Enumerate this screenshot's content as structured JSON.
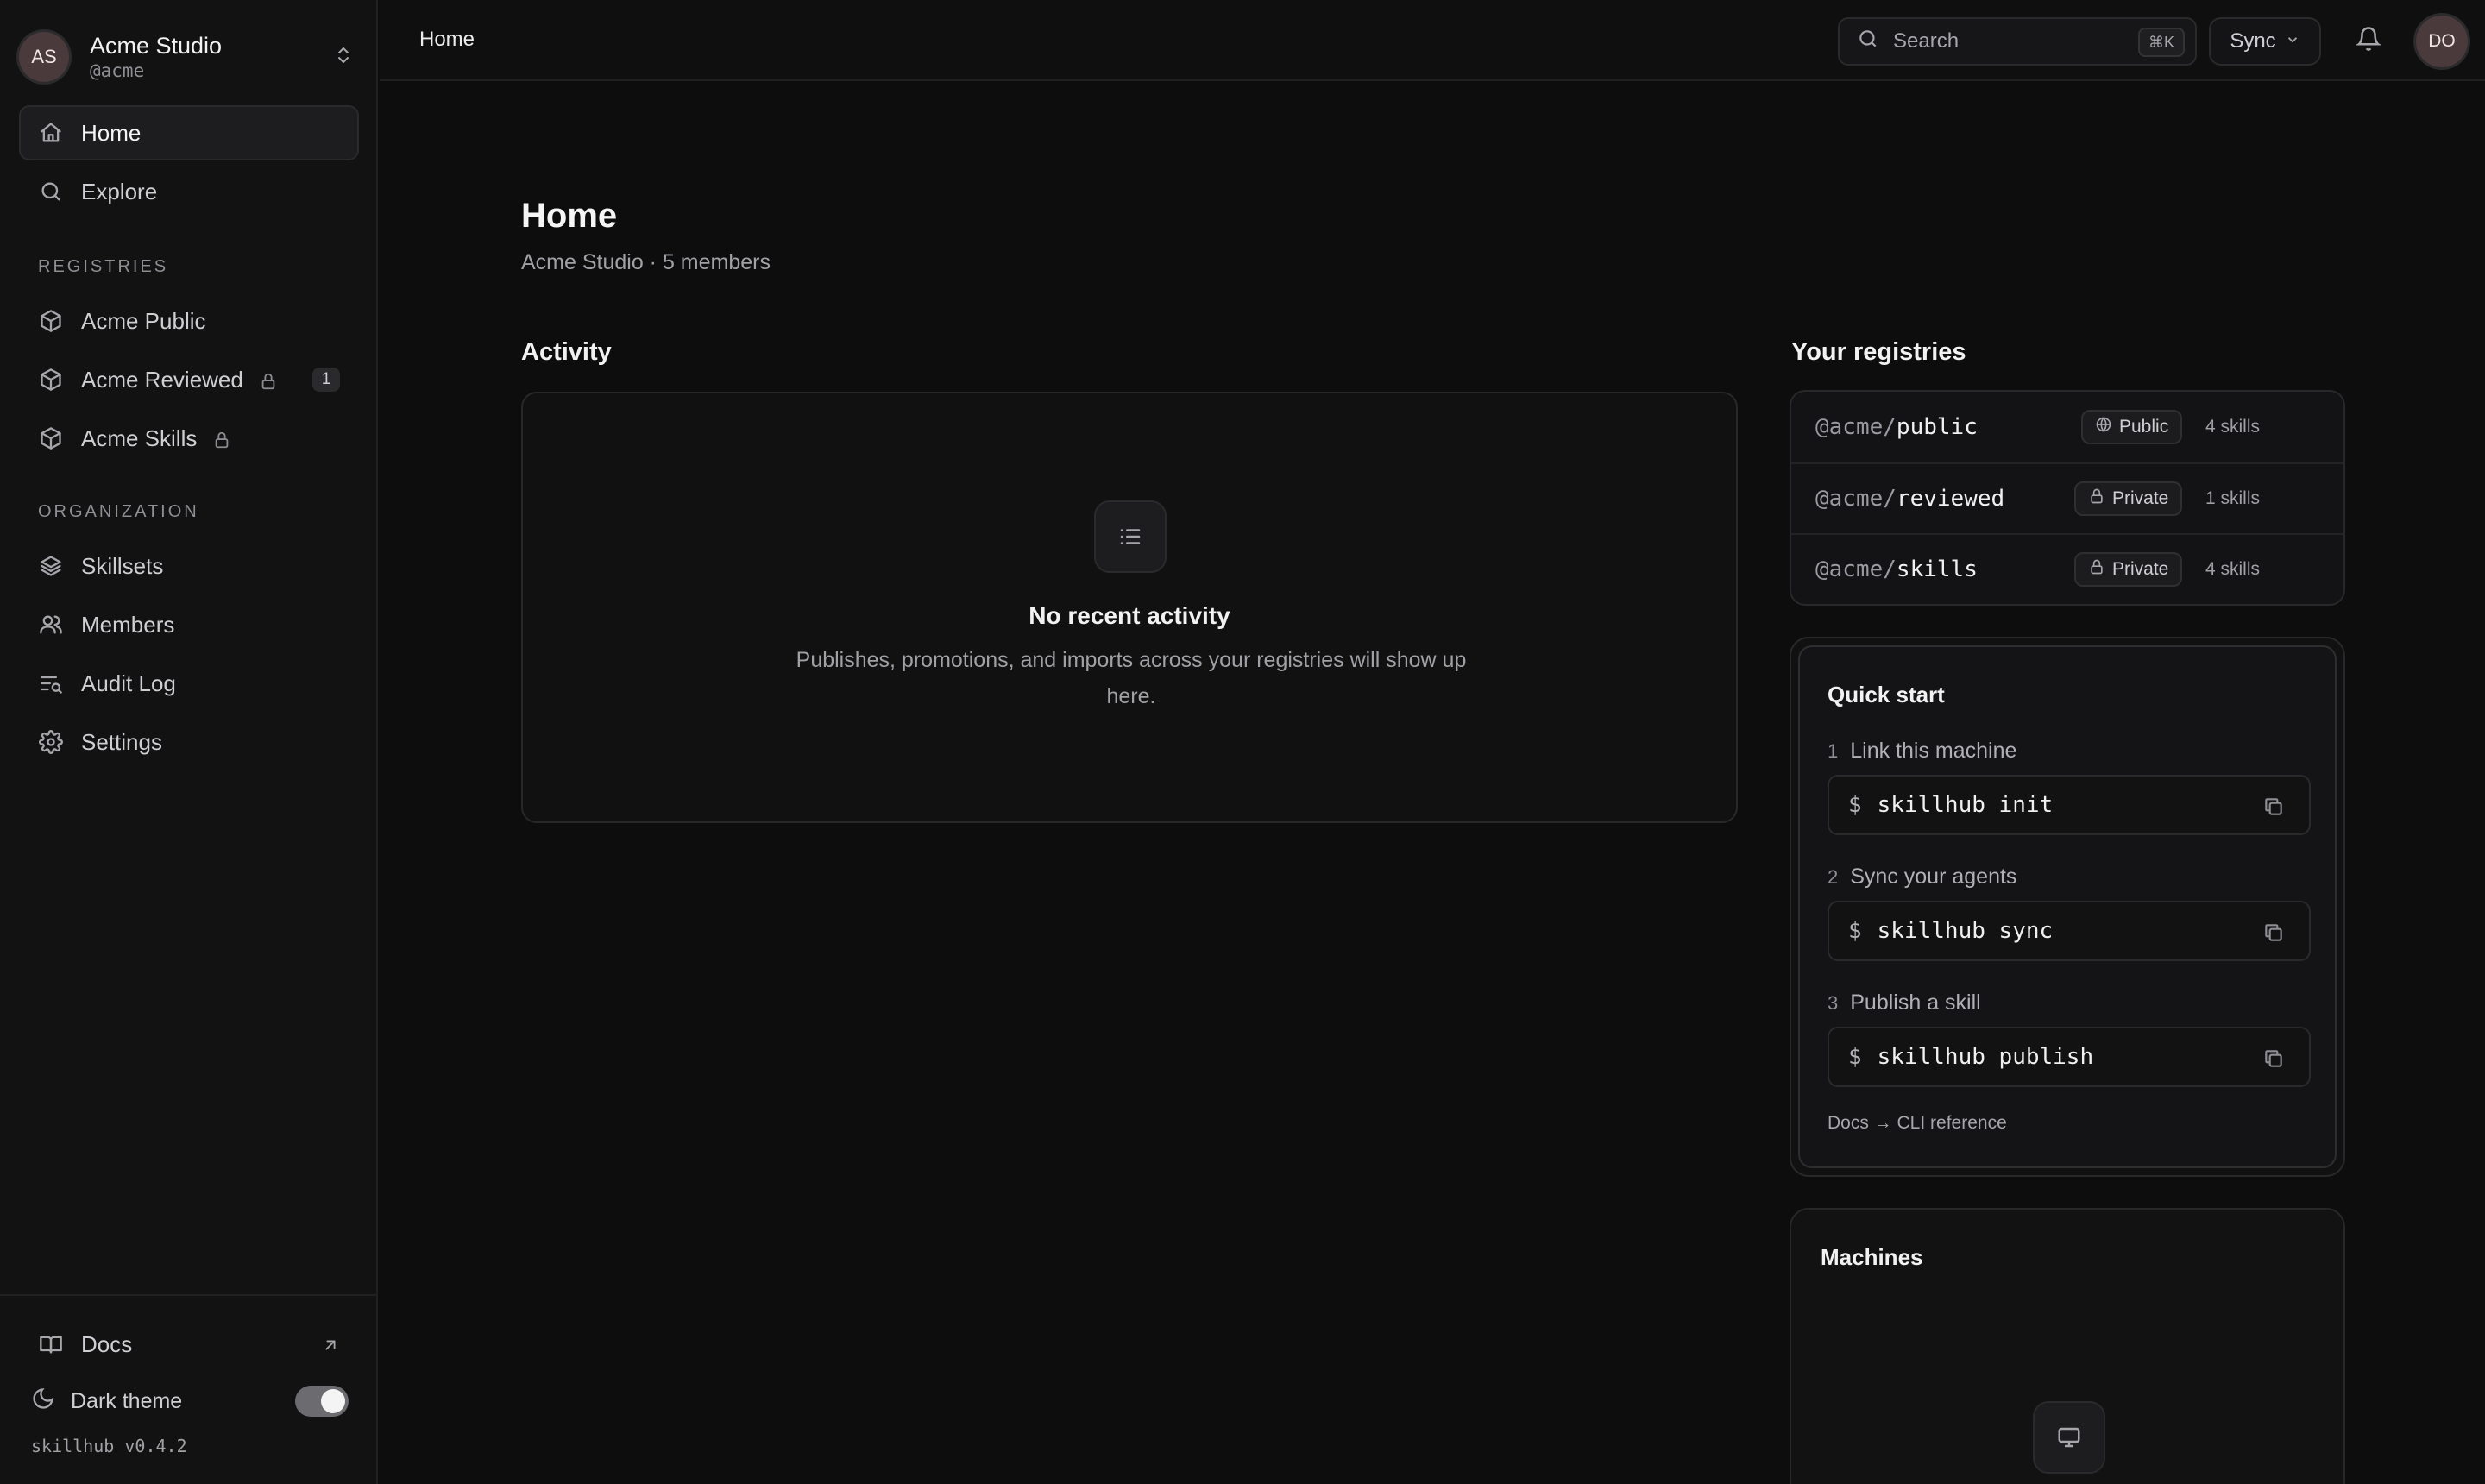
{
  "org": {
    "initials": "AS",
    "name": "Acme Studio",
    "handle": "@acme"
  },
  "nav": {
    "home": "Home",
    "explore": "Explore",
    "registries_label": "REGISTRIES",
    "registries": [
      {
        "label": "Acme Public"
      },
      {
        "label": "Acme Reviewed",
        "locked": true,
        "badge": "1"
      },
      {
        "label": "Acme Skills",
        "locked": true
      }
    ],
    "organization_label": "ORGANIZATION",
    "organization": [
      {
        "label": "Skillsets",
        "icon": "layers-icon"
      },
      {
        "label": "Members",
        "icon": "users-icon"
      },
      {
        "label": "Audit Log",
        "icon": "audit-log-icon"
      },
      {
        "label": "Settings",
        "icon": "gear-icon"
      }
    ]
  },
  "sidebar_footer": {
    "docs": "Docs",
    "dark_theme": "Dark theme",
    "dark_theme_on": true,
    "version": "skillhub v0.4.2"
  },
  "topbar": {
    "breadcrumb": "Home",
    "search_placeholder": "Search",
    "search_shortcut": "⌘K",
    "sync_label": "Sync",
    "user_initials": "DO"
  },
  "main": {
    "title": "Home",
    "subtitle": "Acme Studio · 5 members",
    "activity": {
      "heading": "Activity",
      "empty_title": "No recent activity",
      "empty_desc": "Publishes, promotions, and imports across your registries will show up here."
    },
    "registries": {
      "heading": "Your registries",
      "items": [
        {
          "scope": "@acme/",
          "name": "public",
          "visibility": "Public",
          "count": "4 skills"
        },
        {
          "scope": "@acme/",
          "name": "reviewed",
          "visibility": "Private",
          "count": "1 skills"
        },
        {
          "scope": "@acme/",
          "name": "skills",
          "visibility": "Private",
          "count": "4 skills"
        }
      ]
    },
    "quick_start": {
      "title": "Quick start",
      "steps": [
        {
          "num": "1",
          "label": "Link this machine",
          "command": "skillhub init"
        },
        {
          "num": "2",
          "label": "Sync your agents",
          "command": "skillhub sync"
        },
        {
          "num": "3",
          "label": "Publish a skill",
          "command": "skillhub publish"
        }
      ],
      "prompt": "$",
      "links": "Docs → CLI reference"
    },
    "machines": {
      "title": "Machines"
    }
  },
  "colors": {
    "background": "#0d0d0e",
    "sidebar": "#121213",
    "avatar": "#4a3a3b",
    "toggle_on": "#6b6b70"
  }
}
